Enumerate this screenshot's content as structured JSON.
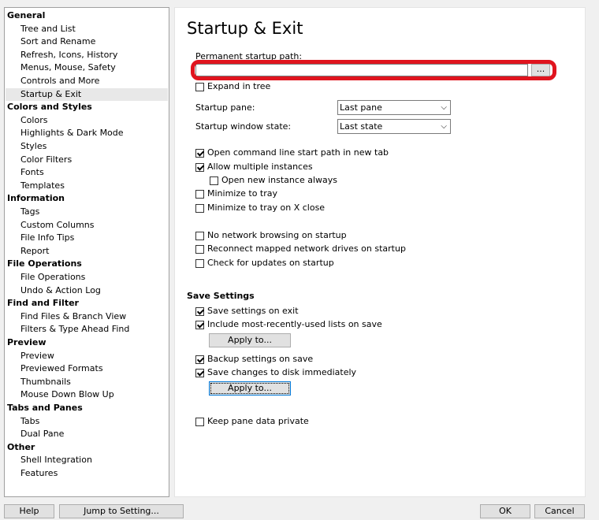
{
  "tree": {
    "items": [
      {
        "label": "General",
        "type": "cat"
      },
      {
        "label": "Tree and List",
        "type": "sub"
      },
      {
        "label": "Sort and Rename",
        "type": "sub"
      },
      {
        "label": "Refresh, Icons, History",
        "type": "sub"
      },
      {
        "label": "Menus, Mouse, Safety",
        "type": "sub"
      },
      {
        "label": "Controls and More",
        "type": "sub"
      },
      {
        "label": "Startup & Exit",
        "type": "sub",
        "selected": true
      },
      {
        "label": "Colors and Styles",
        "type": "cat"
      },
      {
        "label": "Colors",
        "type": "sub"
      },
      {
        "label": "Highlights & Dark Mode",
        "type": "sub"
      },
      {
        "label": "Styles",
        "type": "sub"
      },
      {
        "label": "Color Filters",
        "type": "sub"
      },
      {
        "label": "Fonts",
        "type": "sub"
      },
      {
        "label": "Templates",
        "type": "sub"
      },
      {
        "label": "Information",
        "type": "cat"
      },
      {
        "label": "Tags",
        "type": "sub"
      },
      {
        "label": "Custom Columns",
        "type": "sub"
      },
      {
        "label": "File Info Tips",
        "type": "sub"
      },
      {
        "label": "Report",
        "type": "sub"
      },
      {
        "label": "File Operations",
        "type": "cat"
      },
      {
        "label": "File Operations",
        "type": "sub"
      },
      {
        "label": "Undo & Action Log",
        "type": "sub"
      },
      {
        "label": "Find and Filter",
        "type": "cat"
      },
      {
        "label": "Find Files & Branch View",
        "type": "sub"
      },
      {
        "label": "Filters & Type Ahead Find",
        "type": "sub"
      },
      {
        "label": "Preview",
        "type": "cat"
      },
      {
        "label": "Preview",
        "type": "sub"
      },
      {
        "label": "Previewed Formats",
        "type": "sub"
      },
      {
        "label": "Thumbnails",
        "type": "sub"
      },
      {
        "label": "Mouse Down Blow Up",
        "type": "sub"
      },
      {
        "label": "Tabs and Panes",
        "type": "cat"
      },
      {
        "label": "Tabs",
        "type": "sub"
      },
      {
        "label": "Dual Pane",
        "type": "sub"
      },
      {
        "label": "Other",
        "type": "cat"
      },
      {
        "label": "Shell Integration",
        "type": "sub"
      },
      {
        "label": "Features",
        "type": "sub"
      }
    ]
  },
  "page": {
    "title": "Startup & Exit",
    "path_label": "Permanent startup path:",
    "path_value": "",
    "browse_label": "...",
    "expand_in_tree": {
      "label": "Expand in tree",
      "checked": false
    },
    "startup_pane": {
      "label": "Startup pane:",
      "value": "Last pane"
    },
    "startup_window_state": {
      "label": "Startup window state:",
      "value": "Last state"
    },
    "options": [
      {
        "key": "open_cmd",
        "label": "Open command line start path in new tab",
        "checked": true
      },
      {
        "key": "allow_multi",
        "label": "Allow multiple instances",
        "checked": true
      },
      {
        "key": "open_new",
        "label": "Open new instance always",
        "checked": false
      },
      {
        "key": "min_tray",
        "label": "Minimize to tray",
        "checked": false
      },
      {
        "key": "min_tray_close",
        "label": "Minimize to tray on X close",
        "checked": false
      },
      {
        "key": "no_network",
        "label": "No network browsing on startup",
        "checked": false
      },
      {
        "key": "reconnect",
        "label": "Reconnect mapped network drives on startup",
        "checked": false
      },
      {
        "key": "check_updates",
        "label": "Check for updates on startup",
        "checked": false
      }
    ],
    "save_settings": {
      "title": "Save Settings",
      "save_on_exit": {
        "label": "Save settings on exit",
        "checked": true
      },
      "include_mru": {
        "label": "Include most-recently-used lists on save",
        "checked": true
      },
      "apply_to_1": "Apply to...",
      "backup": {
        "label": "Backup settings on save",
        "checked": true
      },
      "save_immediately": {
        "label": "Save changes to disk immediately",
        "checked": true
      },
      "apply_to_2": "Apply to..."
    },
    "keep_private": {
      "label": "Keep pane data private",
      "checked": false
    }
  },
  "footer": {
    "help": "Help",
    "jump": "Jump to Setting...",
    "ok": "OK",
    "cancel": "Cancel"
  },
  "colors": {
    "highlight_ring": "#e0141e"
  }
}
